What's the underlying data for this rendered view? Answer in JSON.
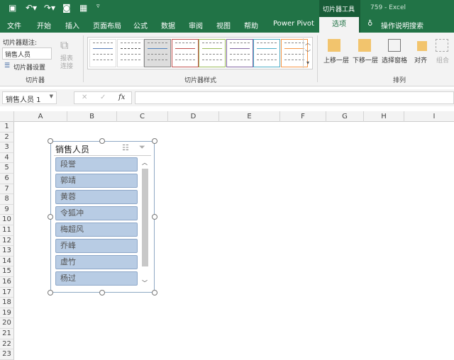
{
  "app": {
    "context_tab": "切片器工具",
    "title": "759  -  Excel"
  },
  "tabs": [
    "文件",
    "开始",
    "插入",
    "页面布局",
    "公式",
    "数据",
    "审阅",
    "视图",
    "帮助",
    "Power Pivot",
    "选项",
    "操作说明搜索"
  ],
  "ribbon": {
    "caption_label": "切片器题注:",
    "caption_value": "销售人员",
    "settings_label": "切片器设置",
    "report_conn": "报表连接",
    "group_slicer": "切片器",
    "group_styles": "切片器样式",
    "style_colors": [
      "#5b7fb6",
      "#555555",
      "#4f81bd",
      "#c0504d",
      "#9bbb59",
      "#8064a2",
      "#4bacc6",
      "#f79646"
    ],
    "arrange": [
      "上移一层",
      "下移一层",
      "选择窗格",
      "对齐",
      "组合"
    ],
    "group_arrange": "排列"
  },
  "formula_bar": {
    "name_box": "销售人员 1",
    "fx": "fx"
  },
  "columns": [
    "A",
    "B",
    "C",
    "D",
    "E",
    "F",
    "G",
    "H",
    "I"
  ],
  "rows": [
    "1",
    "2",
    "3",
    "4",
    "5",
    "6",
    "7",
    "8",
    "9",
    "10",
    "11",
    "12",
    "13",
    "14",
    "15",
    "16",
    "17",
    "18",
    "19",
    "20",
    "21",
    "22",
    "23"
  ],
  "slicer": {
    "title": "销售人员",
    "items": [
      "段誉",
      "郭靖",
      "黄蓉",
      "令狐冲",
      "梅超风",
      "乔峰",
      "虚竹",
      "杨过"
    ]
  }
}
